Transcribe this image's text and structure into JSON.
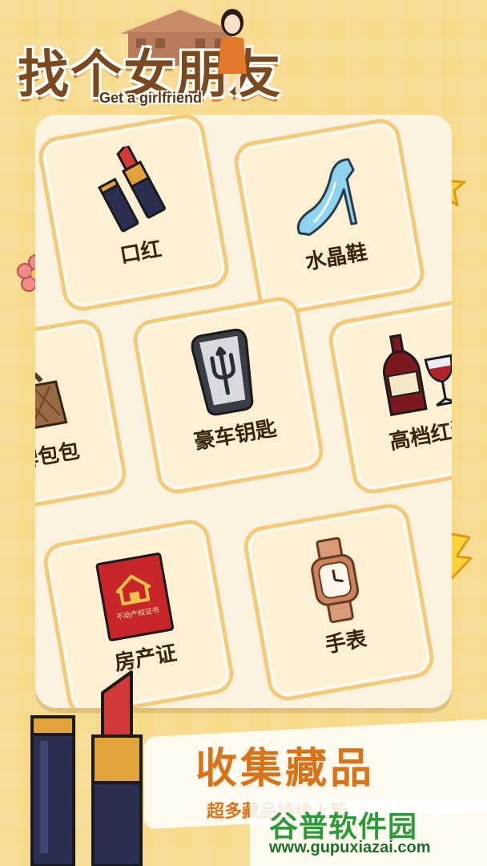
{
  "header": {
    "title": "找个女朋友",
    "subtitle": "Get a girlfriend"
  },
  "cards": [
    {
      "label": "口红",
      "icon": "lipstick-icon"
    },
    {
      "label": "水晶鞋",
      "icon": "crystal-shoe-icon"
    },
    {
      "label": "名牌包包",
      "icon": "handbag-icon"
    },
    {
      "label": "豪车钥匙",
      "icon": "car-key-icon"
    },
    {
      "label": "高档红酒",
      "icon": "wine-icon"
    },
    {
      "label": "房产证",
      "icon": "property-deed-icon"
    },
    {
      "label": "手表",
      "icon": "watch-icon"
    }
  ],
  "deed_text": "不动产权证书",
  "banner": {
    "title": "收集藏品",
    "subtitle": "超多藏品持续上新"
  },
  "watermark": {
    "name": "谷普软件园",
    "url": "www.gupuxiazai.com"
  },
  "colors": {
    "background": "#f7d98a",
    "panel": "#fbf3df",
    "card_border": "#f3c97a",
    "accent": "#d9731a"
  }
}
